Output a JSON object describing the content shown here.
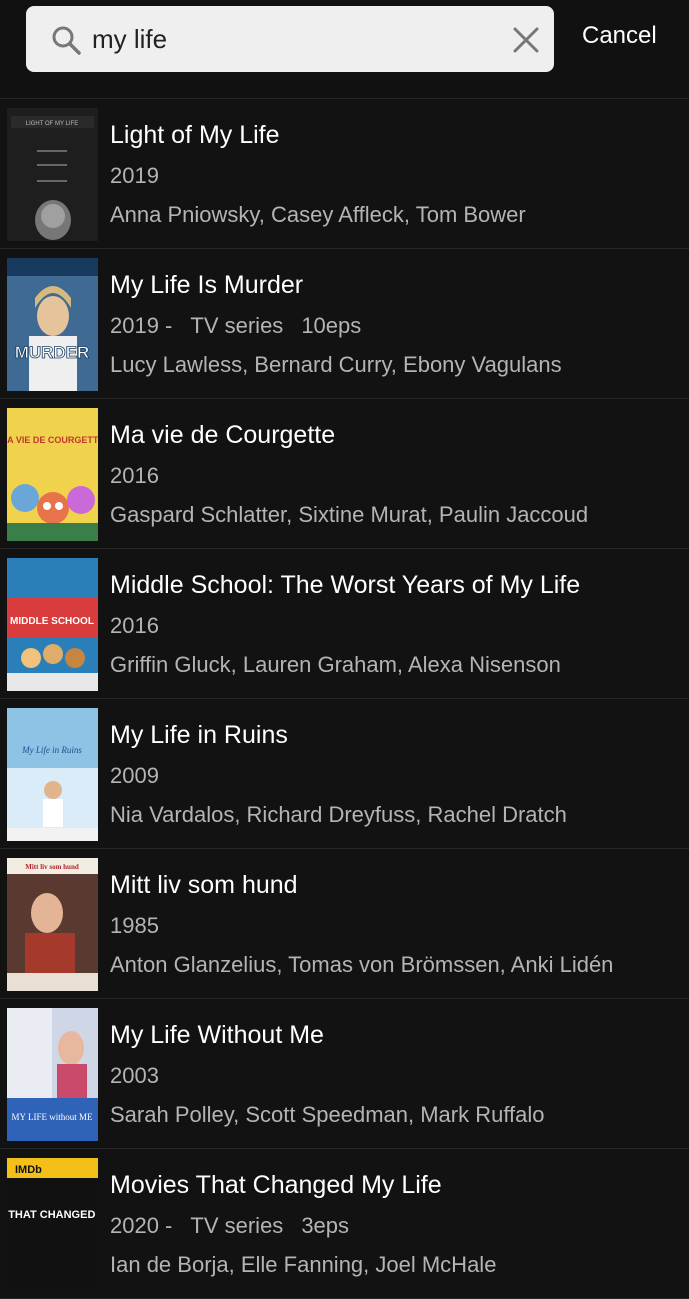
{
  "search": {
    "value": "my life",
    "icon": "search-icon",
    "clear_icon": "close-icon",
    "cancel_label": "Cancel"
  },
  "results": [
    {
      "title": "Light of My Life",
      "year": "2019",
      "type": "",
      "eps": "",
      "cast": "Anna Pniowsky, Casey Affleck, Tom Bower",
      "poster_text": "LIGHT OF MY LIFE"
    },
    {
      "title": "My Life Is Murder",
      "year": "2019 -",
      "type": "TV series",
      "eps": "10eps",
      "cast": "Lucy Lawless, Bernard Curry, Ebony Vagulans",
      "poster_text": "MURDER"
    },
    {
      "title": "Ma vie de Courgette",
      "year": "2016",
      "type": "",
      "eps": "",
      "cast": "Gaspard Schlatter, Sixtine Murat, Paulin Jaccoud",
      "poster_text": "MA VIE DE COURGETTE"
    },
    {
      "title": "Middle School: The Worst Years of My Life",
      "year": "2016",
      "type": "",
      "eps": "",
      "cast": "Griffin Gluck, Lauren Graham, Alexa Nisenson",
      "poster_text": "MIDDLE SCHOOL"
    },
    {
      "title": "My Life in Ruins",
      "year": "2009",
      "type": "",
      "eps": "",
      "cast": "Nia Vardalos, Richard Dreyfuss, Rachel Dratch",
      "poster_text": "My Life in Ruins"
    },
    {
      "title": "Mitt liv som hund",
      "year": "1985",
      "type": "",
      "eps": "",
      "cast": "Anton Glanzelius, Tomas von Brömssen, Anki Lidén",
      "poster_text": "Mitt liv som hund"
    },
    {
      "title": "My Life Without Me",
      "year": "2003",
      "type": "",
      "eps": "",
      "cast": "Sarah Polley, Scott Speedman, Mark Ruffalo",
      "poster_text": "MY LIFE without ME"
    },
    {
      "title": "Movies That Changed My Life",
      "year": "2020 -",
      "type": "TV series",
      "eps": "3eps",
      "cast": "Ian de Borja, Elle Fanning, Joel McHale",
      "poster_text": "MOVIES THAT CHANGED MY LIFE"
    }
  ]
}
